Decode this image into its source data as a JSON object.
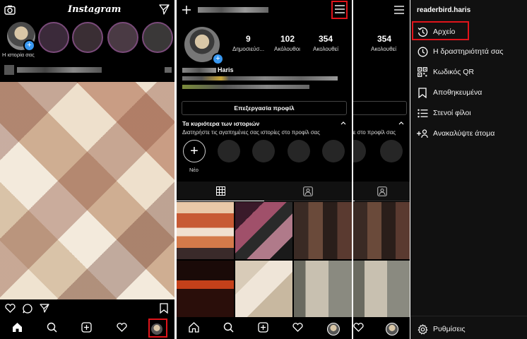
{
  "feed": {
    "app_title": "Instagram",
    "your_story_label": "Η ιστορία σας"
  },
  "profile": {
    "posts_count": "9",
    "posts_label": "Δημοσιεύσ...",
    "followers_count": "102",
    "followers_label": "Ακόλουθοι",
    "following_count": "354",
    "following_label": "Ακολουθεί",
    "name": "Haris",
    "edit_profile_label": "Επεξεργασία προφίλ",
    "highlights_title": "Τα κυριότερα των ιστοριών",
    "highlights_subtitle": "Διατηρήστε τις αγαπημένες σας ιστορίες στο προφίλ σας",
    "new_highlight_label": "Νέο"
  },
  "profile_peek": {
    "following_count": "354",
    "following_label": "Ακολουθεί",
    "subtitle_fragment": "ε στο προφίλ σας"
  },
  "menu": {
    "username": "readerbird.haris",
    "items": [
      {
        "label": "Αρχείο",
        "icon": "archive-icon"
      },
      {
        "label": "Η δραστηριότητά σας",
        "icon": "activity-icon"
      },
      {
        "label": "Κωδικός QR",
        "icon": "qr-code-icon"
      },
      {
        "label": "Αποθηκευμένα",
        "icon": "bookmark-icon"
      },
      {
        "label": "Στενοί φίλοι",
        "icon": "close-friends-icon"
      },
      {
        "label": "Ανακαλύψτε άτομα",
        "icon": "discover-people-icon"
      }
    ],
    "settings_label": "Ρυθμίσεις"
  },
  "colors": {
    "highlight_red": "#e0141b",
    "badge_blue": "#3897f0",
    "background": "#000000"
  }
}
